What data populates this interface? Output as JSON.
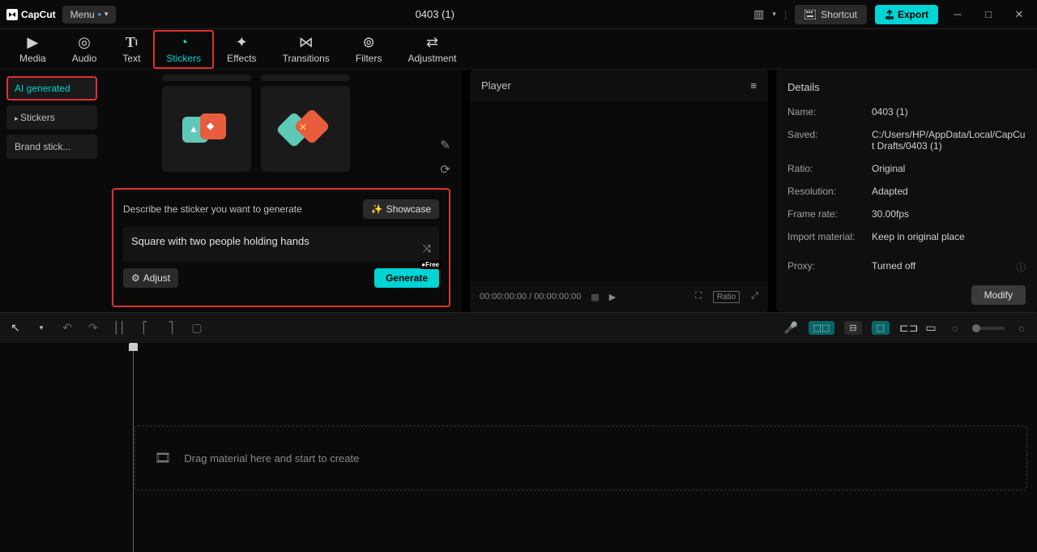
{
  "titlebar": {
    "app_name": "CapCut",
    "menu_label": "Menu",
    "project_title": "0403 (1)",
    "shortcut_label": "Shortcut",
    "export_label": "Export"
  },
  "tabs": {
    "media": "Media",
    "audio": "Audio",
    "text": "Text",
    "stickers": "Stickers",
    "effects": "Effects",
    "transitions": "Transitions",
    "filters": "Filters",
    "adjustment": "Adjustment"
  },
  "sidebar": {
    "ai_generated": "AI generated",
    "stickers": "Stickers",
    "brand": "Brand stick..."
  },
  "gen": {
    "describe_label": "Describe the sticker you want to generate",
    "showcase_label": "Showcase",
    "prompt_text": "Square with two people holding hands",
    "adjust_label": "Adjust",
    "generate_label": "Generate",
    "free_badge": "●Free"
  },
  "player": {
    "title": "Player",
    "time": "00:00:00:00 / 00:00:00:00",
    "ratio_badge": "Ratio"
  },
  "details": {
    "title": "Details",
    "rows": {
      "name_label": "Name:",
      "name_value": "0403 (1)",
      "saved_label": "Saved:",
      "saved_value": "C:/Users/HP/AppData/Local/CapCut Drafts/0403 (1)",
      "ratio_label": "Ratio:",
      "ratio_value": "Original",
      "resolution_label": "Resolution:",
      "resolution_value": "Adapted",
      "framerate_label": "Frame rate:",
      "framerate_value": "30.00fps",
      "import_label": "Import material:",
      "import_value": "Keep in original place",
      "proxy_label": "Proxy:",
      "proxy_value": "Turned off"
    },
    "modify_label": "Modify"
  },
  "timeline": {
    "drop_hint": "Drag material here and start to create"
  }
}
